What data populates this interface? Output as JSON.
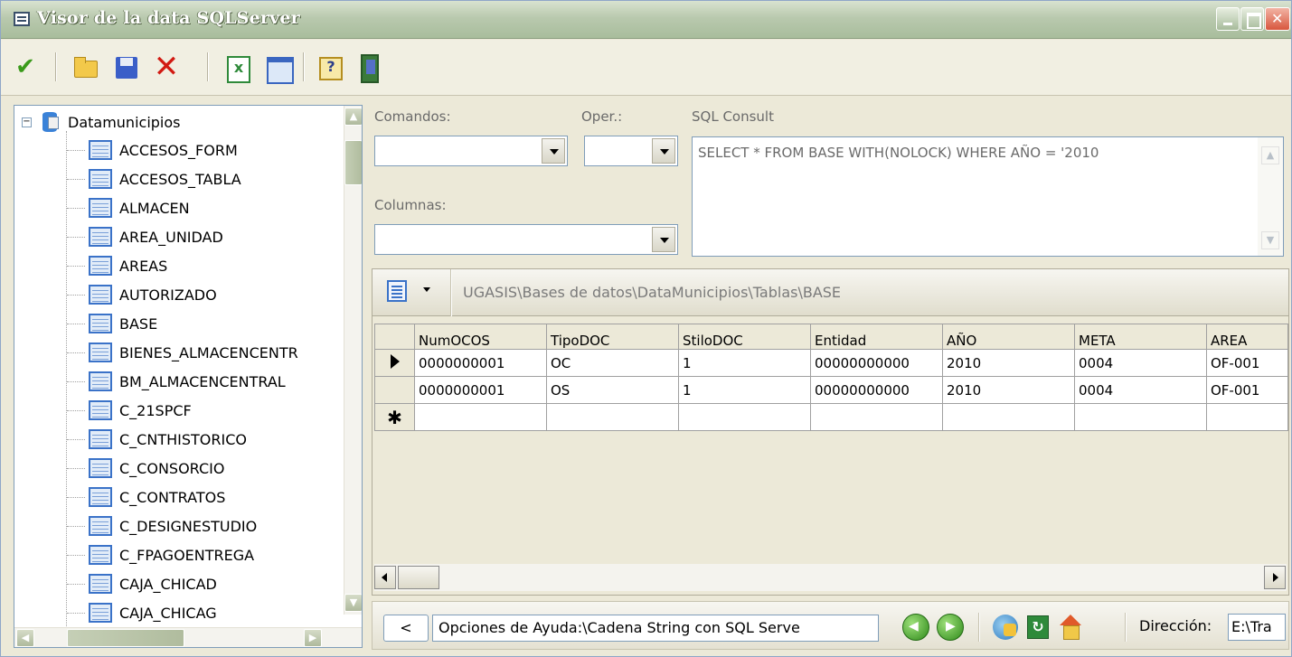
{
  "window": {
    "title": "Visor de la data SQLServer"
  },
  "toolbar": {
    "icons": [
      "check-icon",
      "open-folder-icon",
      "save-icon",
      "delete-icon",
      "excel-export-icon",
      "grid-view-icon",
      "help-icon",
      "exit-icon"
    ]
  },
  "tree": {
    "root": "Datamunicipios",
    "items": [
      "ACCESOS_FORM",
      "ACCESOS_TABLA",
      "ALMACEN",
      "AREA_UNIDAD",
      "AREAS",
      "AUTORIZADO",
      "BASE",
      "BIENES_ALMACENCENTR",
      "BM_ALMACENCENTRAL",
      "C_21SPCF",
      "C_CNTHISTORICO",
      "C_CONSORCIO",
      "C_CONTRATOS",
      "C_DESIGNESTUDIO",
      "C_FPAGOENTREGA",
      "CAJA_CHICAD",
      "CAJA_CHICAG"
    ]
  },
  "query": {
    "comandos_label": "Comandos:",
    "oper_label": "Oper.:",
    "sql_label": "SQL Consult",
    "columnas_label": "Columnas:",
    "sql_text": "SELECT * FROM BASE WITH(NOLOCK) WHERE AÑO = '2010",
    "comandos_value": "",
    "oper_value": "",
    "columnas_value": ""
  },
  "grid": {
    "path": "UGASIS\\Bases de datos\\DataMunicipios\\Tablas\\BASE",
    "columns": [
      "NumOCOS",
      "TipoDOC",
      "StiloDOC",
      "Entidad",
      "AÑO",
      "META",
      "AREA"
    ],
    "rows": [
      [
        "0000000001",
        "OC",
        "1",
        "00000000000",
        "2010",
        "0004",
        "OF-001"
      ],
      [
        "0000000001",
        "OS",
        "1",
        "00000000000",
        "2010",
        "0004",
        "OF-001"
      ]
    ]
  },
  "navbar": {
    "back_label": "<",
    "help_path": "Opciones de Ayuda:\\Cadena String con SQL Serve",
    "address_label": "Dirección:",
    "address_value": "E:\\Tra"
  },
  "colors": {
    "titlebar": "#b9c9ae",
    "panel_bg": "#ece9d8",
    "border": "#7f9db9"
  }
}
